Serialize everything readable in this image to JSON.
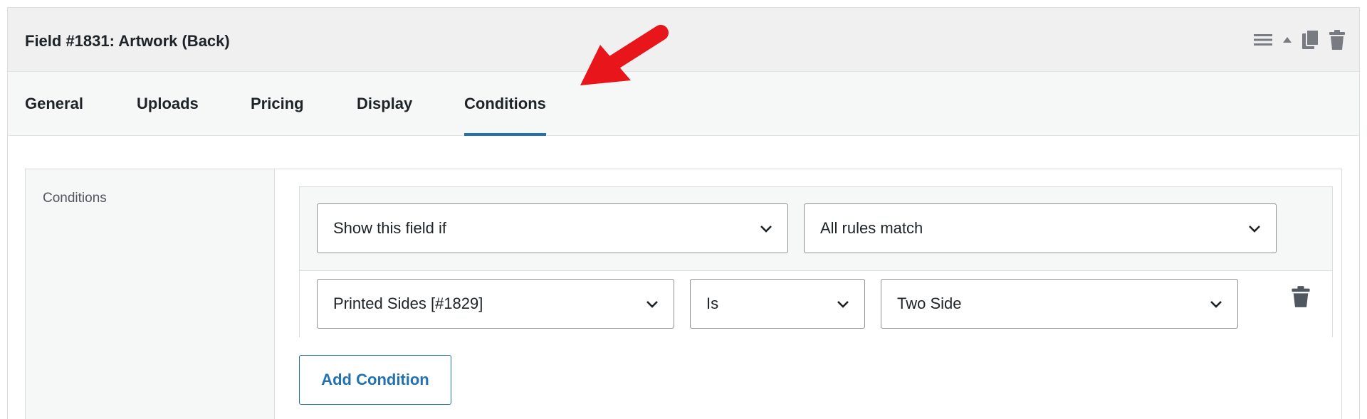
{
  "field": {
    "title": "Field #1831: Artwork (Back)"
  },
  "header_actions": [
    {
      "name": "drag-handle-icon"
    },
    {
      "name": "collapse-arrow-icon"
    },
    {
      "name": "duplicate-icon"
    },
    {
      "name": "trash-icon"
    }
  ],
  "tabs": [
    {
      "label": "General",
      "active": false
    },
    {
      "label": "Uploads",
      "active": false
    },
    {
      "label": "Pricing",
      "active": false
    },
    {
      "label": "Display",
      "active": false
    },
    {
      "label": "Conditions",
      "active": true
    }
  ],
  "conditions": {
    "section_label": "Conditions",
    "visibility_select": "Show this field if",
    "match_select": "All rules match",
    "rule": {
      "field_select": "Printed Sides [#1829]",
      "operator_select": "Is",
      "value_select": "Two Side"
    },
    "add_condition_label": "Add Condition"
  },
  "colors": {
    "accent": "#2271b1",
    "annotation_arrow": "#e8151b",
    "header_bg": "#f0f0f1",
    "tabs_bg": "#f6f7f7"
  }
}
